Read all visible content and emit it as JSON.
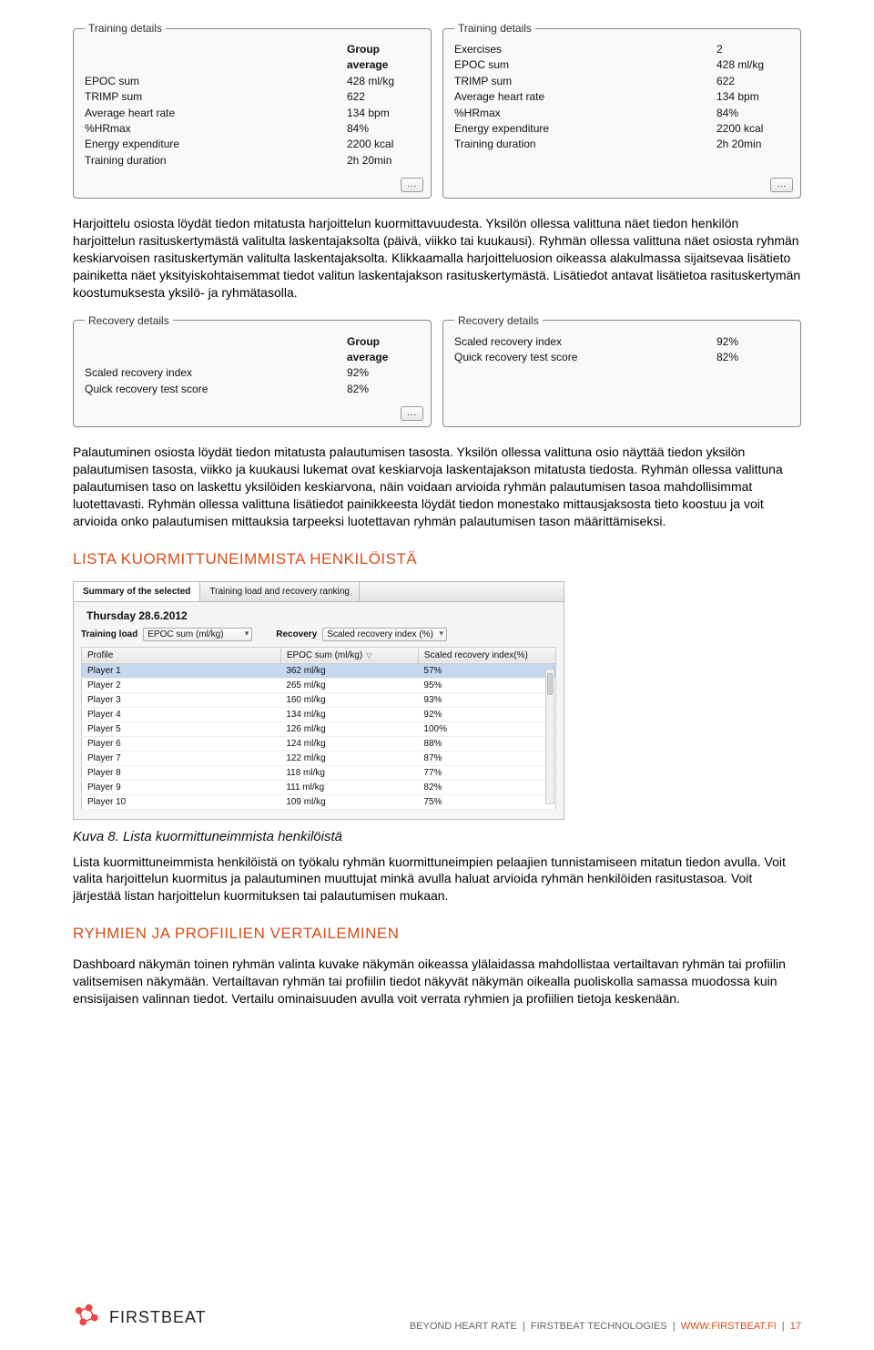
{
  "training_panel_left": {
    "legend": "Training details",
    "head_right": "Group average",
    "rows": [
      {
        "label": "EPOC sum",
        "value": "428 ml/kg"
      },
      {
        "label": "TRIMP sum",
        "value": "622"
      },
      {
        "label": "Average heart rate",
        "value": "134 bpm"
      },
      {
        "label": "%HRmax",
        "value": "84%"
      },
      {
        "label": "Energy expenditure",
        "value": "2200 kcal"
      },
      {
        "label": "Training duration",
        "value": "2h 20min"
      }
    ],
    "more": "..."
  },
  "training_panel_right": {
    "legend": "Training details",
    "rows": [
      {
        "label": "Exercises",
        "value": "2"
      },
      {
        "label": "EPOC sum",
        "value": "428 ml/kg"
      },
      {
        "label": "TRIMP sum",
        "value": "622"
      },
      {
        "label": "Average heart rate",
        "value": "134 bpm"
      },
      {
        "label": "%HRmax",
        "value": "84%"
      },
      {
        "label": "Energy expenditure",
        "value": "2200 kcal"
      },
      {
        "label": "Training duration",
        "value": "2h 20min"
      }
    ],
    "more": "..."
  },
  "para1": "Harjoittelu osiosta löydät tiedon mitatusta harjoittelun kuormittavuudesta. Yksilön ollessa valittuna näet tiedon henkilön harjoittelun rasituskertymästä valitulta laskentajaksolta (päivä, viikko tai kuukausi). Ryhmän ollessa valittuna näet osiosta ryhmän keskiarvoisen rasituskertymän valitulta laskentajaksolta. Klikkaamalla harjoitteluosion oikeassa alakulmassa sijaitsevaa lisätieto painiketta näet yksityiskohtaisemmat tiedot valitun laskentajakson rasituskertymästä. Lisätiedot antavat lisätietoa rasituskertymän koostumuksesta yksilö- ja ryhmätasolla.",
  "recovery_panel_left": {
    "legend": "Recovery details",
    "head_right": "Group average",
    "rows": [
      {
        "label": "Scaled recovery index",
        "value": "92%"
      },
      {
        "label": "Quick recovery test score",
        "value": "82%"
      }
    ],
    "more": "..."
  },
  "recovery_panel_right": {
    "legend": "Recovery details",
    "rows": [
      {
        "label": "Scaled recovery index",
        "value": "92%"
      },
      {
        "label": "Quick recovery test score",
        "value": "82%"
      }
    ]
  },
  "para2": "Palautuminen osiosta löydät tiedon mitatusta palautumisen tasosta. Yksilön ollessa valittuna osio näyttää tiedon yksilön palautumisen tasosta, viikko ja kuukausi lukemat ovat keskiarvoja laskentajakson mitatusta tiedosta. Ryhmän ollessa valittuna palautumisen taso on laskettu yksilöiden keskiarvona, näin voidaan arvioida ryhmän palautumisen tasoa mahdollisimmat luotettavasti. Ryhmän ollessa valittuna lisätiedot painikkeesta löydät tiedon monestako mittausjaksosta tieto koostuu ja voit arvioida onko palautumisen mittauksia tarpeeksi luotettavan ryhmän palautumisen tason määrittämiseksi.",
  "heading1": "LISTA KUORMITTUNEIMMISTA HENKILÖISTÄ",
  "ranking": {
    "tabs": [
      "Summary of the selected",
      "Training load and recovery ranking"
    ],
    "date": "Thursday 28.6.2012",
    "controls": {
      "load_label": "Training load",
      "load_value": "EPOC sum (ml/kg)",
      "recovery_label": "Recovery",
      "recovery_value": "Scaled recovery index (%)"
    },
    "columns": [
      "Profile",
      "EPOC sum (ml/kg)",
      "Scaled recovery index(%)"
    ],
    "rows": [
      {
        "profile": "Player 1",
        "epoc": "362 ml/kg",
        "rec": "57%",
        "selected": true
      },
      {
        "profile": "Player 2",
        "epoc": "265 ml/kg",
        "rec": "95%"
      },
      {
        "profile": "Player 3",
        "epoc": "160 ml/kg",
        "rec": "93%"
      },
      {
        "profile": "Player 4",
        "epoc": "134 ml/kg",
        "rec": "92%"
      },
      {
        "profile": "Player 5",
        "epoc": "126 ml/kg",
        "rec": "100%"
      },
      {
        "profile": "Player 6",
        "epoc": "124 ml/kg",
        "rec": "88%"
      },
      {
        "profile": "Player 7",
        "epoc": "122 ml/kg",
        "rec": "87%"
      },
      {
        "profile": "Player 8",
        "epoc": "118 ml/kg",
        "rec": "77%"
      },
      {
        "profile": "Player 9",
        "epoc": "111 ml/kg",
        "rec": "82%"
      },
      {
        "profile": "Player 10",
        "epoc": "109 ml/kg",
        "rec": "75%"
      }
    ]
  },
  "caption1": "Kuva 8. Lista kuormittuneimmista henkilöistä",
  "para3": "Lista kuormittuneimmista henkilöistä on työkalu ryhmän kuormittuneimpien pelaajien tunnistamiseen mitatun tiedon avulla. Voit valita harjoittelun kuormitus ja palautuminen muuttujat minkä avulla haluat arvioida ryhmän henkilöiden rasitustasoa. Voit järjestää listan harjoittelun kuormituksen tai palautumisen mukaan.",
  "heading2": "RYHMIEN JA PROFIILIEN VERTAILEMINEN",
  "para4": "Dashboard näkymän toinen ryhmän valinta kuvake näkymän oikeassa ylälaidassa mahdollistaa vertailtavan ryhmän tai profiilin valitsemisen näkymään. Vertailtavan ryhmän tai profiilin tiedot näkyvät näkymän oikealla puoliskolla samassa muodossa kuin ensisijaisen valinnan tiedot. Vertailu ominaisuuden avulla voit verrata ryhmien ja profiilien tietoja keskenään.",
  "footer": {
    "logo": "FIRSTBEAT",
    "tagline": "BEYOND HEART RATE",
    "company": "FIRSTBEAT TECHNOLOGIES",
    "url": "WWW.FIRSTBEAT.FI",
    "page": "17"
  }
}
